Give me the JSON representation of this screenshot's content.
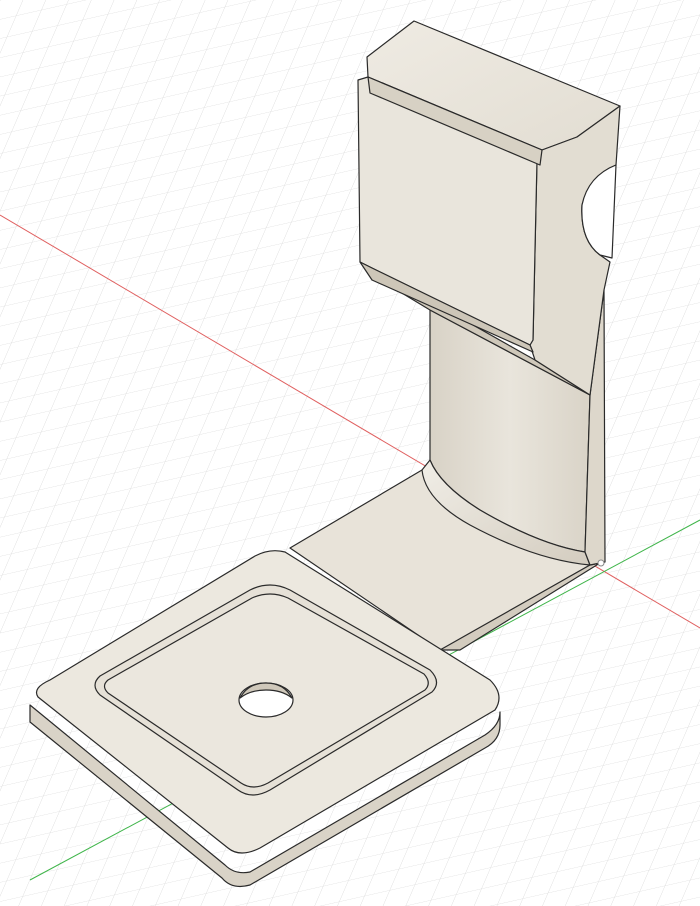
{
  "viewport": {
    "background": "#ffffff",
    "grid_color": "#d9d9d9",
    "x_axis_color": "#e06060",
    "y_axis_color": "#3fb54a"
  },
  "model": {
    "body_color": "#ece8df",
    "face_light": "#f1eee7",
    "face_mid": "#e6e1d7",
    "face_dark": "#d6d0c3",
    "edge_color": "#2a2a2a",
    "origin_marker": "point-icon"
  }
}
